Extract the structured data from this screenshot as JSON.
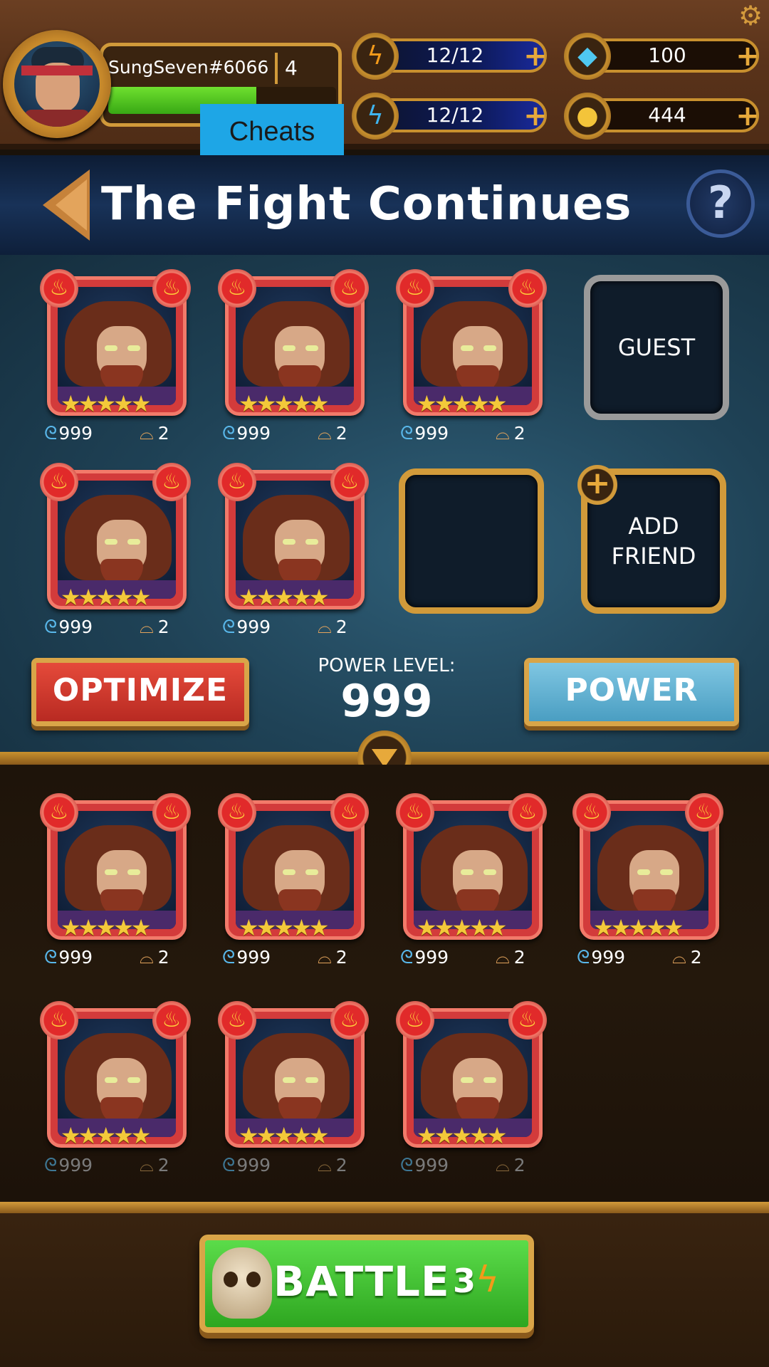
{
  "player": {
    "name": "SungSeven#6066",
    "level": "4",
    "xp_fraction": 0.65
  },
  "cheats_label": "Cheats",
  "resources": {
    "energy_red": {
      "value": "12/12",
      "icon": "lightning-bolt-icon"
    },
    "energy_blue": {
      "value": "12/12",
      "icon": "blue-lightning-icon"
    },
    "gems": {
      "value": "100",
      "icon": "gem-icon"
    },
    "coins": {
      "value": "444",
      "icon": "coin-icon"
    }
  },
  "title": "The Fight Continues",
  "help_label": "?",
  "team_slots": {
    "guest": "GUEST",
    "add_friend_line1": "ADD",
    "add_friend_line2": "FRIEND"
  },
  "hero_stats": {
    "power": "999",
    "level": "2"
  },
  "buttons": {
    "optimize": "OPTIMIZE",
    "power": "POWER"
  },
  "power_level": {
    "label": "POWER LEVEL:",
    "value": "999"
  },
  "battle": {
    "label": "BATTLE",
    "cost": "3"
  },
  "colors": {
    "card_border": "#d33b3b",
    "battle_green": "#3cc02a",
    "optimize_red": "#d63a2e",
    "power_blue": "#5aaed0"
  }
}
